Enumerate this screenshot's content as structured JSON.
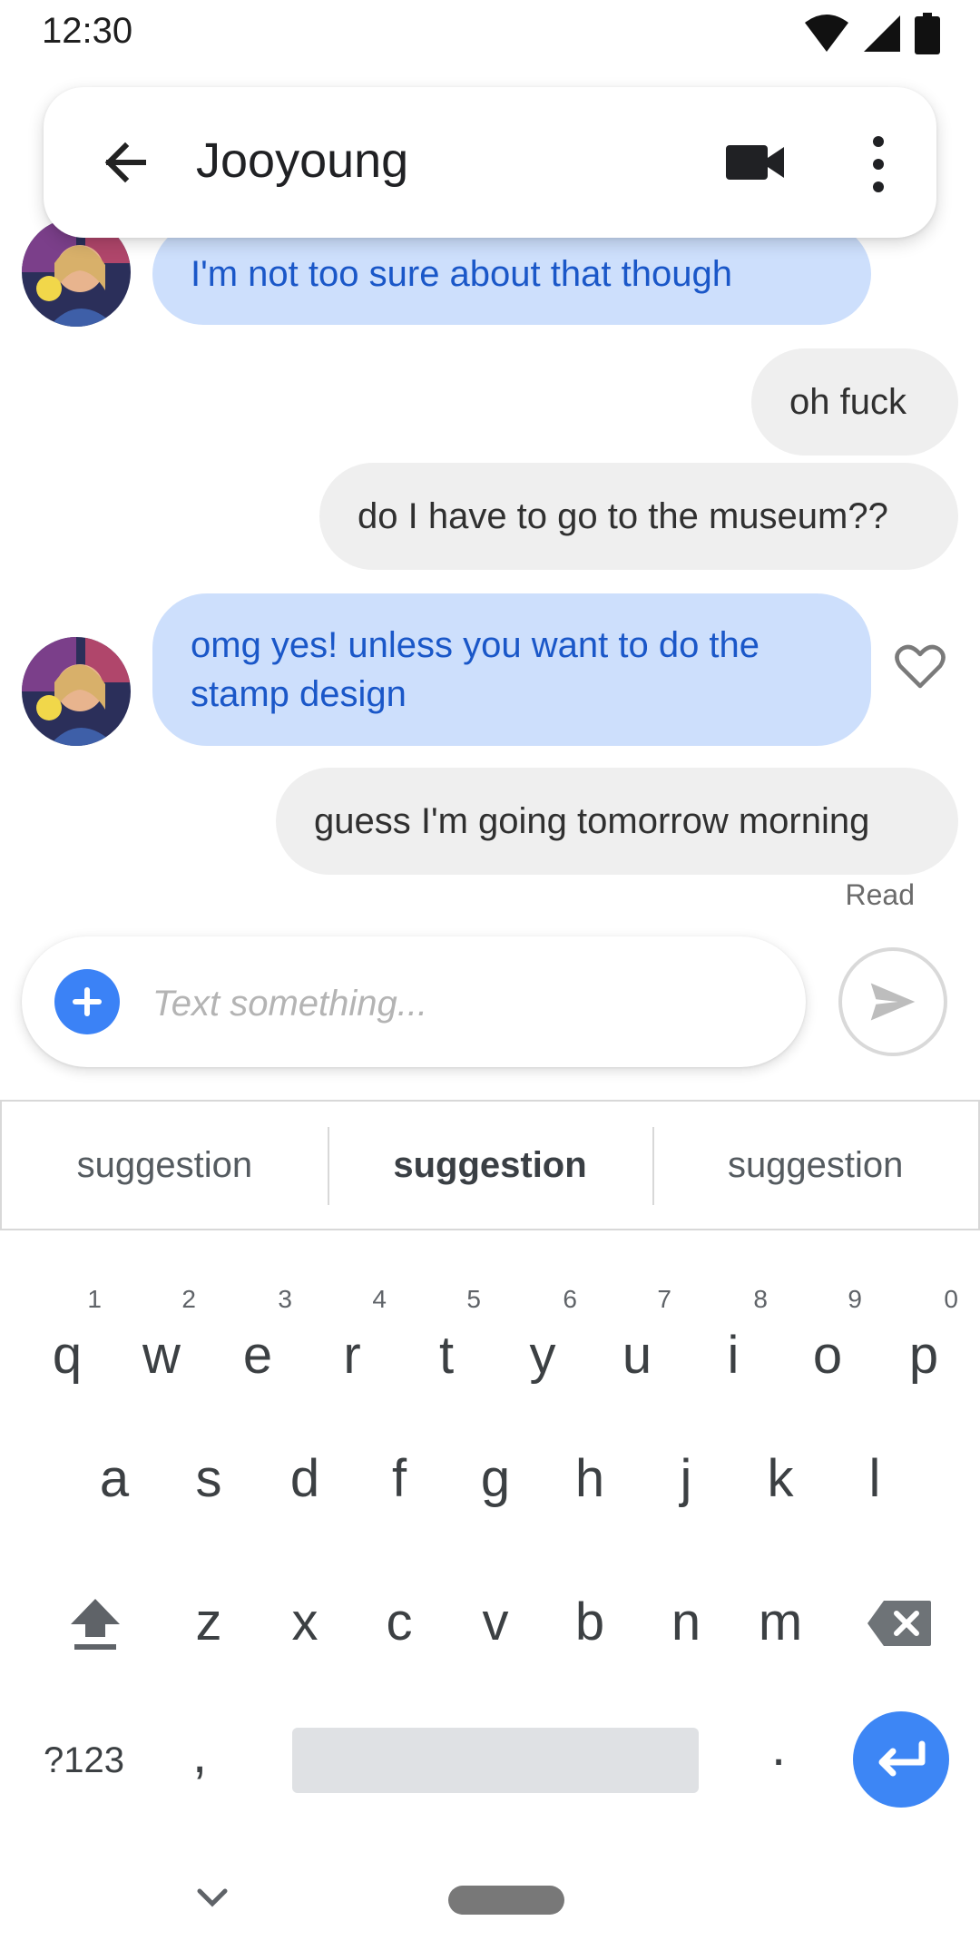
{
  "status_bar": {
    "time": "12:30"
  },
  "header": {
    "contact_name": "Jooyoung"
  },
  "messages": [
    {
      "direction": "incoming",
      "text": "I'm not too sure about that though"
    },
    {
      "direction": "outgoing",
      "text": "oh fuck"
    },
    {
      "direction": "outgoing",
      "text": "do I have to go to the museum??"
    },
    {
      "direction": "incoming",
      "text": "omg yes! unless you want to do the stamp design"
    },
    {
      "direction": "outgoing",
      "text": "guess I'm going tomorrow morning"
    }
  ],
  "read_receipt": "Read",
  "compose": {
    "placeholder": "Text something..."
  },
  "suggestions": [
    "suggestion",
    "suggestion",
    "suggestion"
  ],
  "keyboard": {
    "row1": [
      {
        "key": "q",
        "num": "1"
      },
      {
        "key": "w",
        "num": "2"
      },
      {
        "key": "e",
        "num": "3"
      },
      {
        "key": "r",
        "num": "4"
      },
      {
        "key": "t",
        "num": "5"
      },
      {
        "key": "y",
        "num": "6"
      },
      {
        "key": "u",
        "num": "7"
      },
      {
        "key": "i",
        "num": "8"
      },
      {
        "key": "o",
        "num": "9"
      },
      {
        "key": "p",
        "num": "0"
      }
    ],
    "row2": [
      "a",
      "s",
      "d",
      "f",
      "g",
      "h",
      "j",
      "k",
      "l"
    ],
    "row3": [
      "z",
      "x",
      "c",
      "v",
      "b",
      "n",
      "m"
    ],
    "symbols_label": "?123",
    "comma": ",",
    "period": "."
  },
  "colors": {
    "incoming_bubble": "#cddffc",
    "incoming_text": "#1a57c8",
    "outgoing_bubble": "#efefef",
    "accent": "#3d86f5"
  },
  "icons": {
    "back": "arrow-back-icon",
    "video": "video-camera-icon",
    "more": "more-vert-icon",
    "heart": "heart-outline-icon",
    "add": "add-circle-icon",
    "send": "send-icon"
  }
}
